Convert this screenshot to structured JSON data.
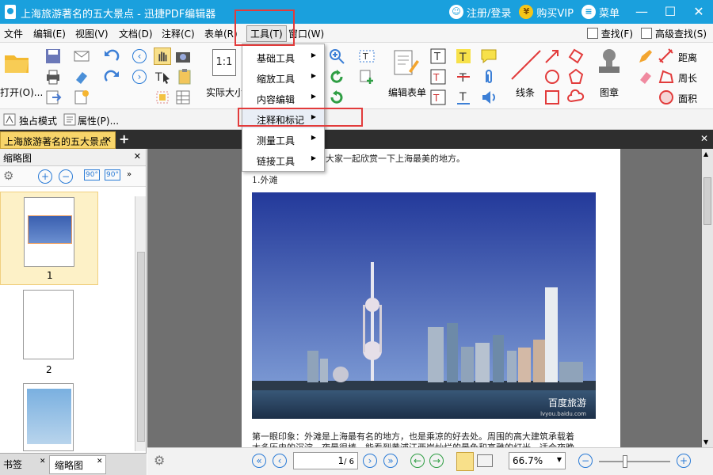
{
  "window": {
    "title": "上海旅游著名的五大景点 - 迅捷PDF编辑器",
    "login": "注册/登录",
    "buy_vip": "购买VIP",
    "menu_label": "菜单"
  },
  "menubar": {
    "items": [
      "文件",
      "编辑(E)",
      "视图(V)",
      "文档(D)",
      "注释(C)",
      "表单(R)",
      "工具(T)",
      "窗口(W)"
    ],
    "find": "查找(F)",
    "advanced_find": "高级查找(S)"
  },
  "ribbon": {
    "open_label": "打开(O)...",
    "actual_size_label": "实际大小",
    "edit_form_label": "编辑表单",
    "line_label": "线条",
    "stamp_label": "图章",
    "distance_label": "距离",
    "perimeter_label": "周长",
    "area_label": "面积"
  },
  "modebar": {
    "exclusive_mode": "独占模式",
    "properties": "属性(P)..."
  },
  "dropdown": {
    "items": [
      "基础工具",
      "缩放工具",
      "内容编辑",
      "注释和标记",
      "测量工具",
      "链接工具"
    ]
  },
  "tabs": {
    "doc_tab": "上海旅游著名的五大景点"
  },
  "left_panel": {
    "title": "缩略图",
    "page_numbers": [
      "1",
      "2"
    ],
    "bookmarks_tab": "书签",
    "thumbnails_tab": "缩略图"
  },
  "document": {
    "line1": "和大家一起欣赏一下上海最美的地方。",
    "heading": "1.外滩",
    "paragraph1": "第一眼印象：外滩是上海最有名的地方，也是乘凉的好去处。周围的高大建筑承载着",
    "paragraph2": "太多历史的沉淀，夜景很棒，能看到黄浦江两岸灿烂的景色和高雅的灯光，适合夜晚",
    "watermark": "百度旅游",
    "watermark_url": "lvyou.baidu.com"
  },
  "statusbar": {
    "page_input": "1",
    "page_total": "/ 6",
    "zoom": "66.7%"
  },
  "colors": {
    "titlebar": "#1aa0dd",
    "highlight": "#e23b3b",
    "tab_active": "#f8d56a"
  }
}
